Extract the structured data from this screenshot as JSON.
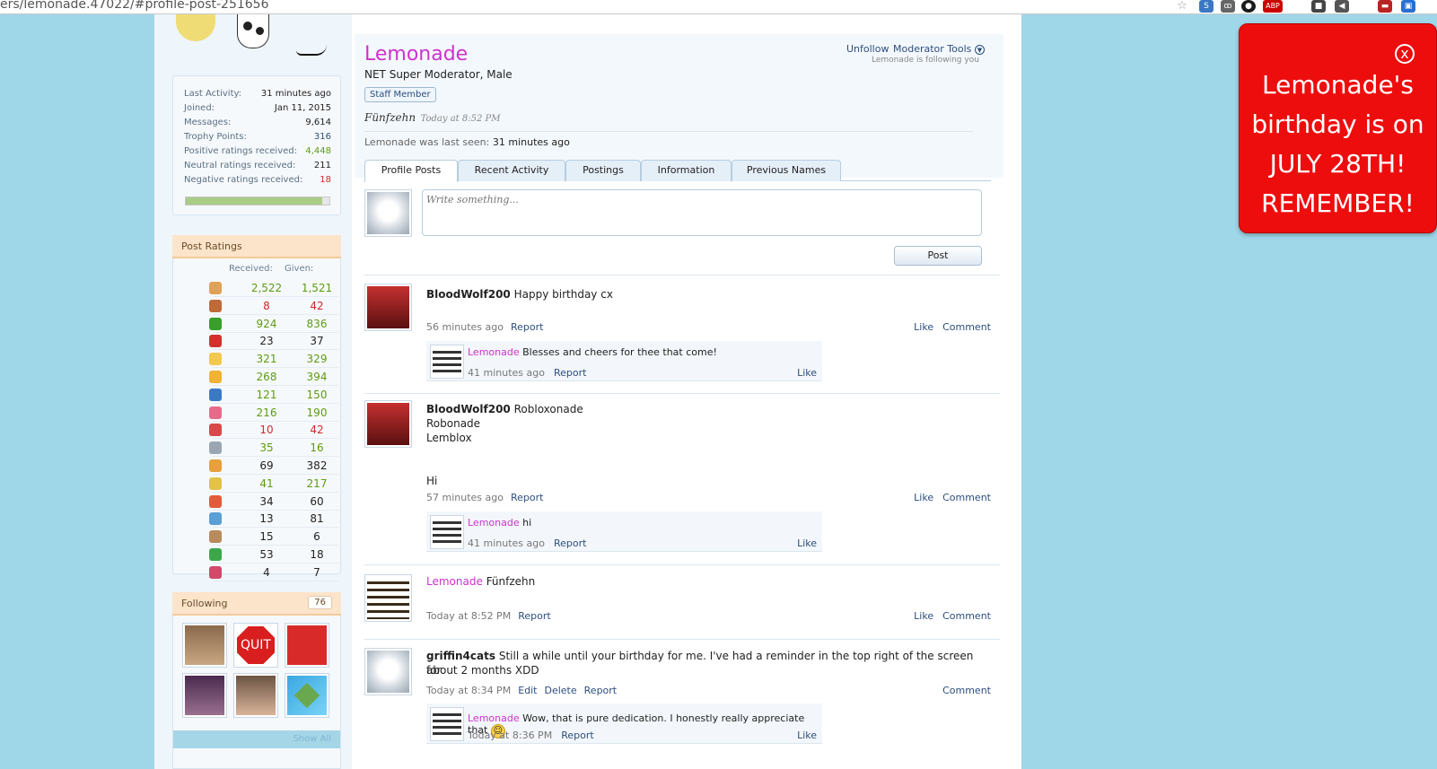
{
  "browser": {
    "url": "ers/lemonade.47022/#profile-post-251656",
    "ext_abp": "ABP",
    "ext_abp_count": "1"
  },
  "profile": {
    "name": "Lemonade",
    "title": "NET Super Moderator, Male",
    "staff_badge": "Staff Member",
    "status_author": "Fünfzehn",
    "status_time": "Today at 8:52 PM",
    "last_seen_label": "Lemonade was last seen:",
    "last_seen_value": "31 minutes ago",
    "unfollow": "Unfollow",
    "moderator_tools": "Moderator Tools",
    "following_you": "Lemonade is following you"
  },
  "stats": [
    {
      "label": "Last Activity:",
      "value": "31 minutes ago"
    },
    {
      "label": "Joined:",
      "value": "Jan 11, 2015"
    },
    {
      "label": "Messages:",
      "value": "9,614"
    },
    {
      "label": "Trophy Points:",
      "value": "316"
    },
    {
      "label": "Positive ratings received:",
      "value": "4,448"
    },
    {
      "label": "Neutral ratings received:",
      "value": "211"
    },
    {
      "label": "Negative ratings received:",
      "value": "18"
    }
  ],
  "rating_ratio": 0.95,
  "post_ratings": {
    "header": "Post Ratings",
    "col_received": "Received:",
    "col_given": "Given:",
    "rows": [
      {
        "icon": "like-icon",
        "received": "2,522",
        "given": "1,521"
      },
      {
        "icon": "dislike-icon",
        "received": "8",
        "given": "42"
      },
      {
        "icon": "agree-icon",
        "received": "924",
        "given": "836"
      },
      {
        "icon": "disagree-icon",
        "received": "23",
        "given": "37"
      },
      {
        "icon": "funny-icon",
        "received": "321",
        "given": "329"
      },
      {
        "icon": "winner-icon",
        "received": "268",
        "given": "394"
      },
      {
        "icon": "informative-icon",
        "received": "121",
        "given": "150"
      },
      {
        "icon": "friendly-icon",
        "received": "216",
        "given": "190"
      },
      {
        "icon": "angry-icon",
        "received": "10",
        "given": "42"
      },
      {
        "icon": "useful-icon",
        "received": "35",
        "given": "16"
      },
      {
        "icon": "creative-icon",
        "received": "69",
        "given": "382"
      },
      {
        "icon": "artistic-icon",
        "received": "41",
        "given": "217"
      },
      {
        "icon": "late-icon",
        "received": "34",
        "given": "60"
      },
      {
        "icon": "spelling-icon",
        "received": "13",
        "given": "81"
      },
      {
        "icon": "cookie-icon",
        "received": "15",
        "given": "6"
      },
      {
        "icon": "optimistic-icon",
        "received": "53",
        "given": "18"
      },
      {
        "icon": "coherent-icon",
        "received": "4",
        "given": "7"
      }
    ]
  },
  "following": {
    "header": "Following",
    "count": "76",
    "show_all": "Show All",
    "quit_label": "QUIT"
  },
  "tabs": [
    "Profile Posts",
    "Recent Activity",
    "Postings",
    "Information",
    "Previous Names"
  ],
  "composer": {
    "placeholder": "Write something...",
    "post_button": "Post"
  },
  "labels": {
    "report": "Report",
    "like": "Like",
    "comment": "Comment",
    "edit": "Edit",
    "delete": "Delete"
  },
  "posts": [
    {
      "author": "BloodWolf200",
      "text": "Happy birthday cx",
      "time": "56 minutes ago",
      "reply": {
        "author": "Lemonade",
        "text": "Blesses and cheers for thee that come!",
        "time": "41 minutes ago"
      }
    },
    {
      "author": "BloodWolf200",
      "text": "Robloxonade",
      "extra": "Robonade\nLemblox\n\n\nHi",
      "time": "57 minutes ago",
      "reply": {
        "author": "Lemonade",
        "text": "hi",
        "time": "41 minutes ago"
      }
    },
    {
      "author": "Lemonade",
      "text": "Fünfzehn",
      "time": "Today at 8:52 PM"
    },
    {
      "author": "griffin4cats",
      "text": "Still a while until your birthday for me. I've had a reminder in the top right of the screen for",
      "extra": "about 2 months XDD",
      "time": "Today at 8:34 PM",
      "reply": {
        "author": "Lemonade",
        "text": "Wow, that is pure dedication. I honestly really appreciate that",
        "time": "Today at 8:36 PM"
      }
    }
  ],
  "reminder": {
    "line1": "Lemonade's",
    "line2": "birthday is on",
    "line3": "JULY 28TH!",
    "line4": "REMEMBER!",
    "close": "x"
  },
  "colors": {
    "background": "#9fd6e8",
    "name_magenta": "#cc33cc",
    "reminder_red": "#ee0d0d",
    "link": "#2d4e7e"
  }
}
